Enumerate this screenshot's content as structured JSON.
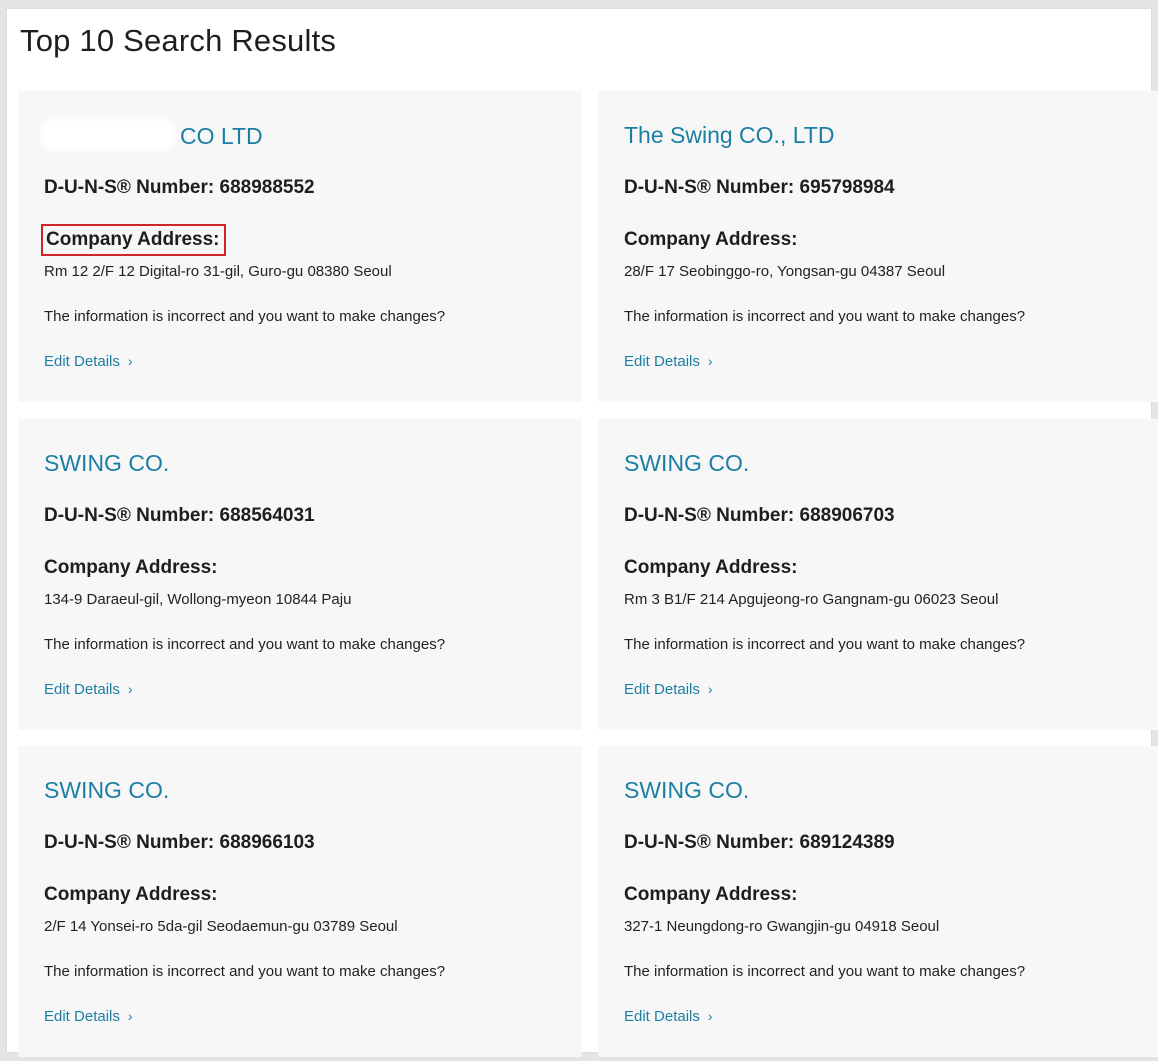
{
  "page": {
    "title": "Top 10 Search Results"
  },
  "labels": {
    "duns_prefix": "D-U-N-S® Number: ",
    "address_label": "Company Address:",
    "prompt": "The information is incorrect and you want to make changes?",
    "edit": "Edit Details",
    "chevron": "›"
  },
  "colors": {
    "link": "#1b7fa4",
    "highlight_border": "#d1232a",
    "card_background": "#f7f7f7"
  },
  "cards": [
    {
      "name": "CO LTD",
      "name_redacted": true,
      "duns": "688988552",
      "address": "Rm 12 2/F 12 Digital-ro 31-gil, Guro-gu 08380 Seoul",
      "address_label_highlighted": true
    },
    {
      "name": "The Swing CO., LTD",
      "duns": "695798984",
      "address": "28/F 17 Seobinggo-ro, Yongsan-gu 04387 Seoul"
    },
    {
      "name": "SWING CO.",
      "duns": "688564031",
      "address": "134-9 Daraeul-gil, Wollong-myeon 10844 Paju"
    },
    {
      "name": "SWING CO.",
      "duns": "688906703",
      "address": "Rm 3 B1/F 214 Apgujeong-ro Gangnam-gu 06023 Seoul"
    },
    {
      "name": "SWING CO.",
      "duns": "688966103",
      "address": "2/F 14 Yonsei-ro 5da-gil Seodaemun-gu 03789 Seoul"
    },
    {
      "name": "SWING CO.",
      "duns": "689124389",
      "address": "327-1 Neungdong-ro Gwangjin-gu 04918 Seoul"
    }
  ]
}
